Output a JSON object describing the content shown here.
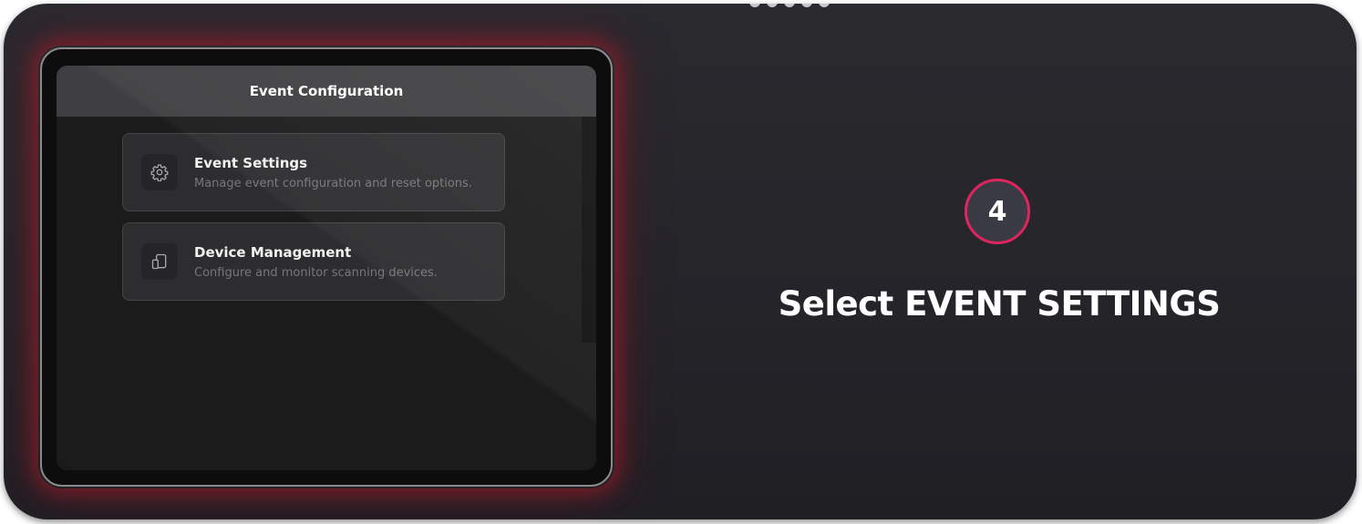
{
  "app": {
    "header_title": "Event Configuration"
  },
  "menu": {
    "items": [
      {
        "title": "Event Settings",
        "description": "Manage event configuration and reset options.",
        "icon": "gear-icon"
      },
      {
        "title": "Device Management",
        "description": "Configure and monitor scanning devices.",
        "icon": "tablet-device-icon"
      }
    ]
  },
  "step": {
    "number": "4",
    "instruction": "Select EVENT SETTINGS"
  },
  "colors": {
    "accent": "#e0245e",
    "panel_background": "#26262b",
    "glow": "#aa1e2d"
  }
}
